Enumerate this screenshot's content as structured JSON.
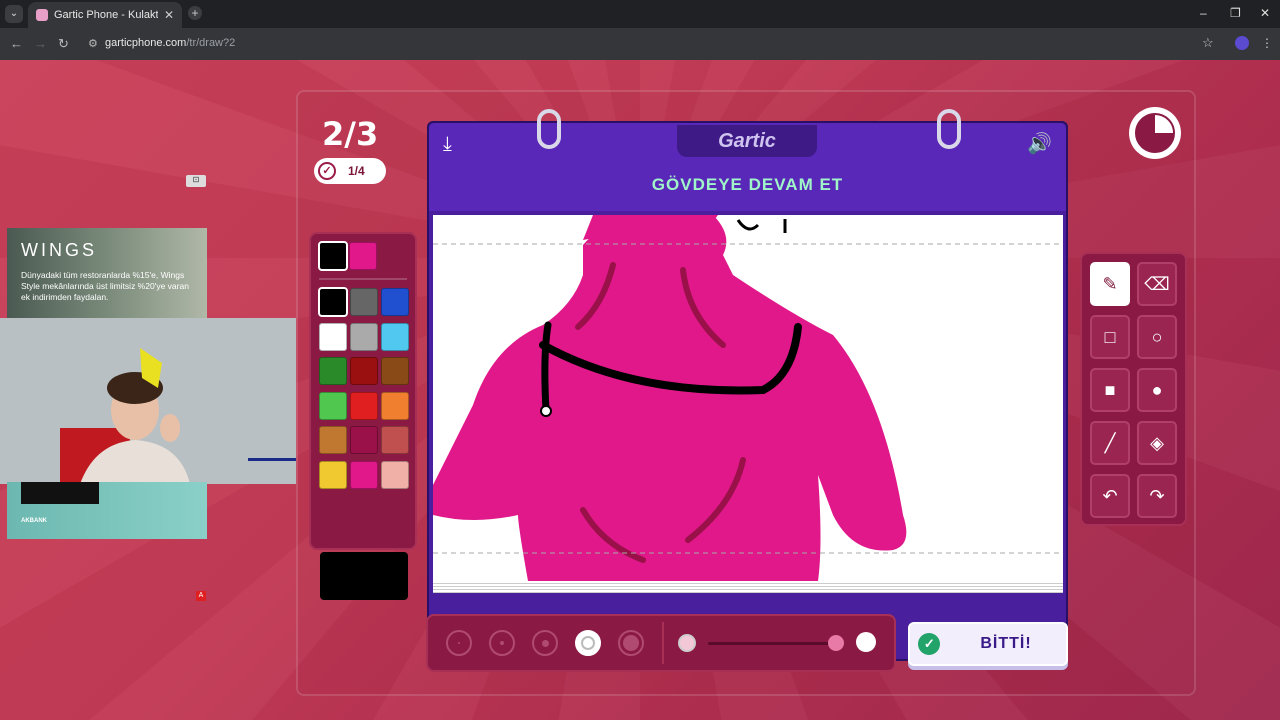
{
  "browser": {
    "tab_title": "Gartic Phone - Kulaktan Kulağa",
    "url_host": "garticphone.com",
    "url_path": "/tr/draw?2",
    "new_tab_symbol": "+",
    "close_symbol": "✕"
  },
  "game": {
    "round": "2/3",
    "progress": "1/4",
    "logo": "Gartic",
    "prompt": "GÖVDEYE DEVAM ET",
    "done_label": "BİTTİ!",
    "timer_remaining_fraction": 0.75
  },
  "palette": {
    "current": [
      "#000000",
      "#e0188a"
    ],
    "colors": [
      "#000000",
      "#666666",
      "#2050d0",
      "#ffffff",
      "#aaaaaa",
      "#50c8f0",
      "#2a8a2a",
      "#9a1010",
      "#8a4a18",
      "#50c850",
      "#e02020",
      "#f08030",
      "#c07830",
      "#9a1048",
      "#c05050",
      "#f0c830",
      "#e0188a",
      "#f0b0a8"
    ],
    "selected_color": "#000000",
    "brush_color": "#000000"
  },
  "brush": {
    "sizes": [
      1,
      2,
      3,
      4,
      5
    ],
    "selected_size": 4,
    "opacity": 0.95
  },
  "tools": [
    "pencil-icon",
    "eraser-icon",
    "rect-outline-icon",
    "circle-outline-icon",
    "rect-filled-icon",
    "circle-filled-icon",
    "line-icon",
    "fill-bucket-icon",
    "undo-icon",
    "redo-icon"
  ],
  "overlays": {
    "ad_brand": "WINGS",
    "ad_text": "Dünyadaki tüm restoranlarda %15'e, Wings Style mekânlarında üst limitsiz %20'ye varan ek indirimden faydalan.",
    "ad2_brand": "AKBANK",
    "badge": "A"
  }
}
